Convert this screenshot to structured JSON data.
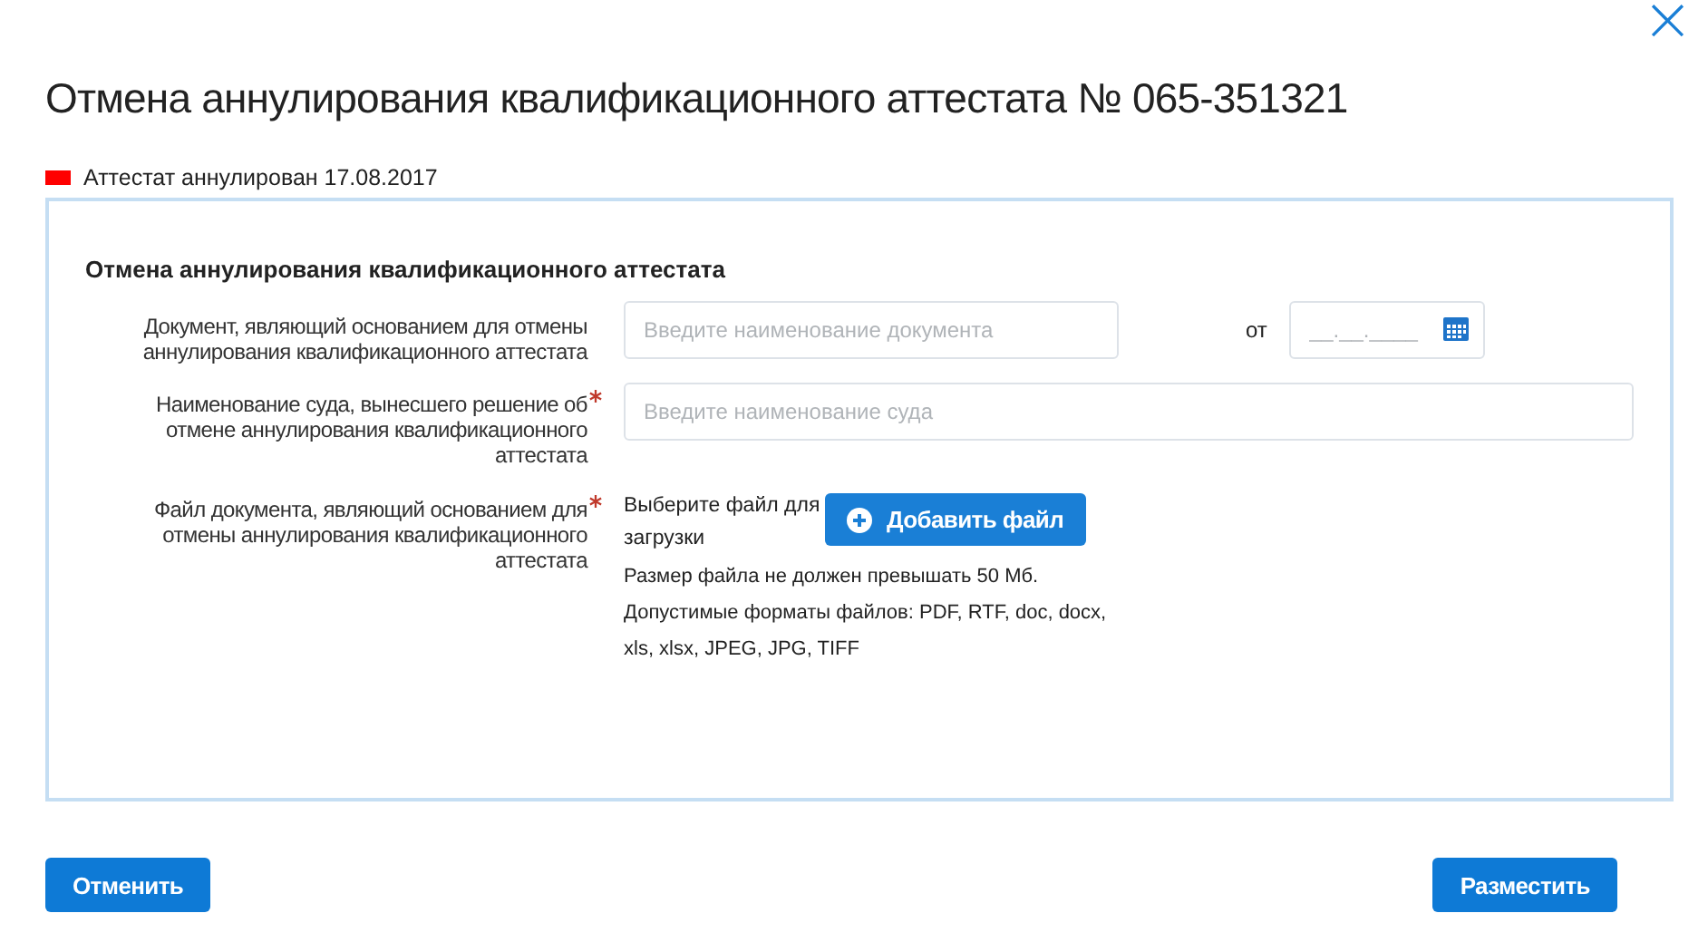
{
  "dialog": {
    "title": "Отмена аннулирования квалификационного аттестата № 065-351321",
    "close": "×"
  },
  "status": {
    "text": "Аттестат аннулирован 17.08.2017",
    "color": "#ff0000"
  },
  "form": {
    "heading": "Отмена аннулирования квалификационного аттестата",
    "fields": [
      {
        "kind": "text_date",
        "label": "Документ, являющий основанием для отмены аннулирования квалификационного аттестата",
        "required": false,
        "placeholder": "Введите наименование документа",
        "date_label": "от",
        "date_placeholder": "__.__.____"
      },
      {
        "kind": "text",
        "label": "Наименование суда, вынесшего решение об отмене аннулирования квалификационного аттестата",
        "required": true,
        "placeholder": "Введите наименование суда"
      },
      {
        "kind": "file",
        "label": "Файл документа, являющий основанием для отмены аннулирования квалификационного аттестата",
        "required": true,
        "prompt": "Выберите файл для загрузки",
        "button": "Добавить файл",
        "notes": [
          "Размер файла не должен превышать 50 Мб.",
          "Допустимые форматы файлов: PDF, RTF, doc, docx, xls, xlsx, JPEG, JPG, TIFF"
        ]
      }
    ]
  },
  "buttons": {
    "cancel": "Отменить",
    "submit": "Разместить"
  }
}
